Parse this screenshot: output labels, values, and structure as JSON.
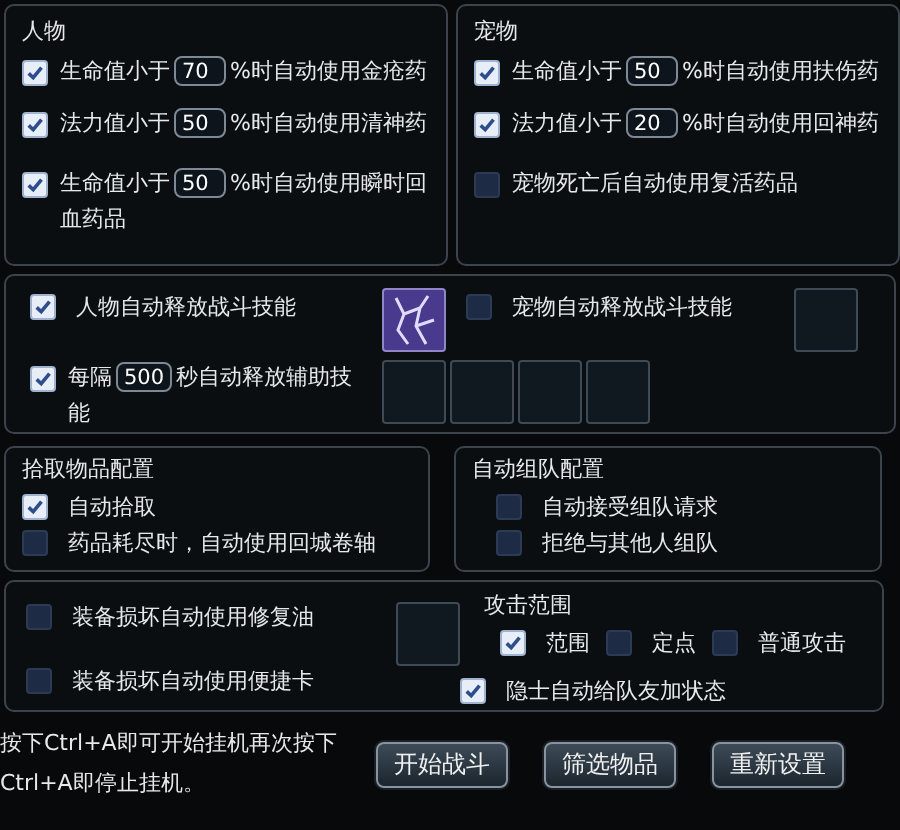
{
  "character": {
    "title": "人物",
    "rows": [
      {
        "kind": "threshold",
        "checked": true,
        "before": "生命值小于",
        "value": "70",
        "after": "%时自动使用金疮药"
      },
      {
        "kind": "threshold",
        "checked": true,
        "before": "法力值小于",
        "value": "50",
        "after": "%时自动使用清神药"
      },
      {
        "kind": "threshold",
        "checked": true,
        "before": "生命值小于",
        "value": "50",
        "after": "%时自动使用瞬时回血药品"
      }
    ]
  },
  "pet": {
    "title": "宠物",
    "rows": [
      {
        "kind": "threshold",
        "checked": true,
        "before": "生命值小于",
        "value": "50",
        "after": "%时自动使用扶伤药"
      },
      {
        "kind": "threshold",
        "checked": true,
        "before": "法力值小于",
        "value": "20",
        "after": "%时自动使用回神药"
      },
      {
        "kind": "toggle",
        "checked": false,
        "label": "宠物死亡后自动使用复活药品"
      }
    ]
  },
  "skills": {
    "character_skill": {
      "checked": true,
      "label": "人物自动释放战斗技能",
      "slot_filled": true
    },
    "pet_skill": {
      "checked": false,
      "label": "宠物自动释放战斗技能",
      "slot_filled": false
    },
    "buff": {
      "checked": true,
      "before": "每隔",
      "value": "500",
      "after": "秒自动释放辅助技能",
      "slots": [
        {
          "filled": false
        },
        {
          "filled": false
        },
        {
          "filled": false
        },
        {
          "filled": false
        }
      ]
    }
  },
  "pickup": {
    "title": "拾取物品配置",
    "options": [
      {
        "label": "自动拾取",
        "checked": true
      },
      {
        "label": "药品耗尽时，自动使用回城卷轴",
        "checked": false
      }
    ]
  },
  "team": {
    "title": "自动组队配置",
    "options": [
      {
        "label": "自动接受组队请求",
        "checked": false
      },
      {
        "label": "拒绝与其他人组队",
        "checked": false
      }
    ]
  },
  "equipment": {
    "options": [
      {
        "label": "装备损坏自动使用修复油",
        "checked": false
      },
      {
        "label": "装备损坏自动使用便捷卡",
        "checked": false
      }
    ]
  },
  "attack_range": {
    "title": "攻击范围",
    "options": [
      {
        "label": "范围",
        "checked": true
      },
      {
        "label": "定点",
        "checked": false
      },
      {
        "label": "普通攻击",
        "checked": false
      }
    ]
  },
  "hermit": {
    "label": "隐士自动给队友加状态",
    "checked": true
  },
  "hint": [
    "按下Ctrl+A即可开始挂机再次按下",
    "Ctrl+A即停止挂机。"
  ],
  "buttons": [
    "开始战斗",
    "筛选物品",
    "重新设置"
  ]
}
